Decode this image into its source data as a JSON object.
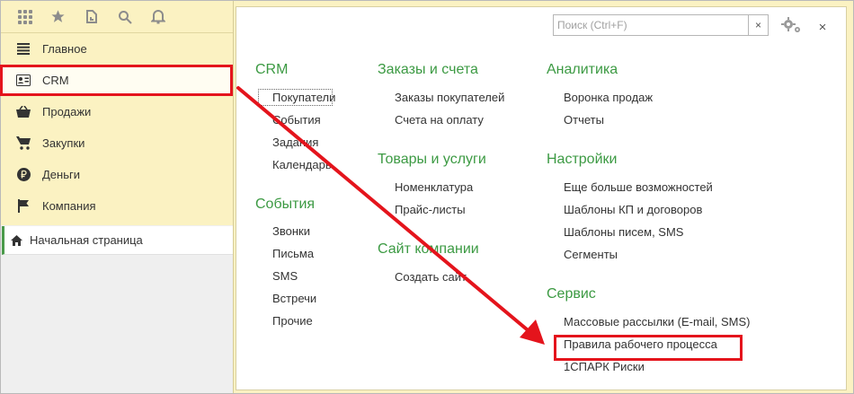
{
  "topbar": {
    "icons": [
      "apps-grid-icon",
      "star-icon",
      "history-icon",
      "search-icon",
      "bell-icon"
    ]
  },
  "sidebar": {
    "items": [
      {
        "label": "Главное",
        "icon": "menu-lines-icon"
      },
      {
        "label": "CRM",
        "icon": "contact-card-icon",
        "active": true
      },
      {
        "label": "Продажи",
        "icon": "basket-icon"
      },
      {
        "label": "Закупки",
        "icon": "cart-icon"
      },
      {
        "label": "Деньги",
        "icon": "ruble-coin-icon"
      },
      {
        "label": "Компания",
        "icon": "flag-icon"
      }
    ],
    "home": "Начальная страница"
  },
  "search": {
    "placeholder": "Поиск (Ctrl+F)",
    "clear": "×"
  },
  "close_label": "×",
  "columns": {
    "c1": {
      "s1": {
        "title": "CRM",
        "links": [
          "Покупатели",
          "События",
          "Задания",
          "Календарь"
        ]
      },
      "s2": {
        "title": "События",
        "links": [
          "Звонки",
          "Письма",
          "SMS",
          "Встречи",
          "Прочие"
        ]
      }
    },
    "c2": {
      "s1": {
        "title": "Заказы и счета",
        "links": [
          "Заказы покупателей",
          "Счета на оплату"
        ]
      },
      "s2": {
        "title": "Товары и услуги",
        "links": [
          "Номенклатура",
          "Прайс-листы"
        ]
      },
      "s3": {
        "title": "Сайт компании",
        "links": [
          "Создать сайт"
        ]
      }
    },
    "c3": {
      "s1": {
        "title": "Аналитика",
        "links": [
          "Воронка продаж",
          "Отчеты"
        ]
      },
      "s2": {
        "title": "Настройки",
        "links": [
          "Еще больше возможностей",
          "Шаблоны КП и договоров",
          "Шаблоны писем, SMS",
          "Сегменты"
        ]
      },
      "s3": {
        "title": "Сервис",
        "links": [
          "Массовые рассылки (E-mail, SMS)",
          "Правила рабочего процесса",
          "1СПАРК Риски"
        ]
      }
    }
  },
  "colors": {
    "accent_green": "#3c9a43",
    "highlight_red": "#e4141c",
    "panel_yellow": "#fbf2c2"
  }
}
